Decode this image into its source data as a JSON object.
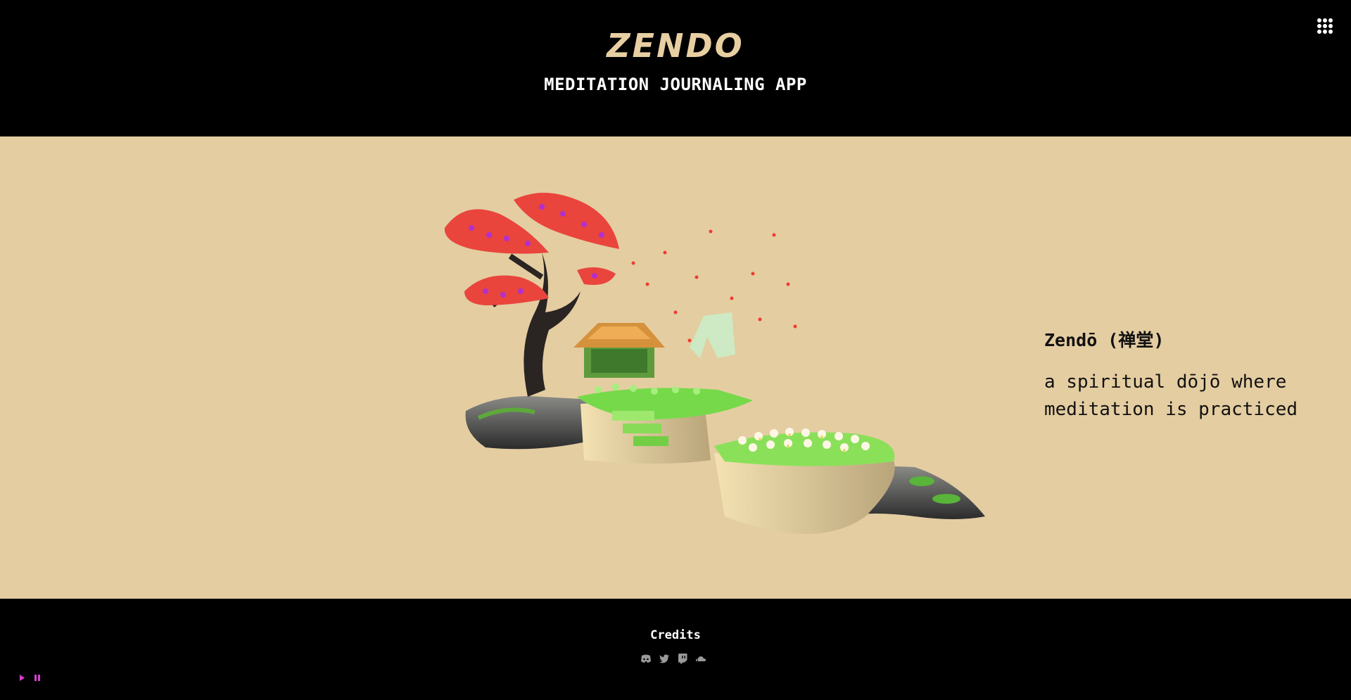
{
  "header": {
    "logo": "ZENDO",
    "subtitle": "MEDITATION JOURNALING APP",
    "menu_icon": "grid-menu-icon"
  },
  "hero": {
    "term": "Zendō (禅堂)",
    "definition": "a spiritual dōjō where meditation is practiced",
    "scene": "3d-zen-garden-island"
  },
  "footer": {
    "credits_label": "Credits",
    "social_icons": [
      "discord-icon",
      "twitter-icon",
      "twitch-icon",
      "soundcloud-icon"
    ]
  },
  "player": {
    "icons": [
      "play-icon",
      "pause-icon"
    ],
    "accent": "#d63fd1"
  },
  "colors": {
    "background": "#000000",
    "hero_background": "#e4cda1",
    "logo": "#e8cfa2"
  }
}
